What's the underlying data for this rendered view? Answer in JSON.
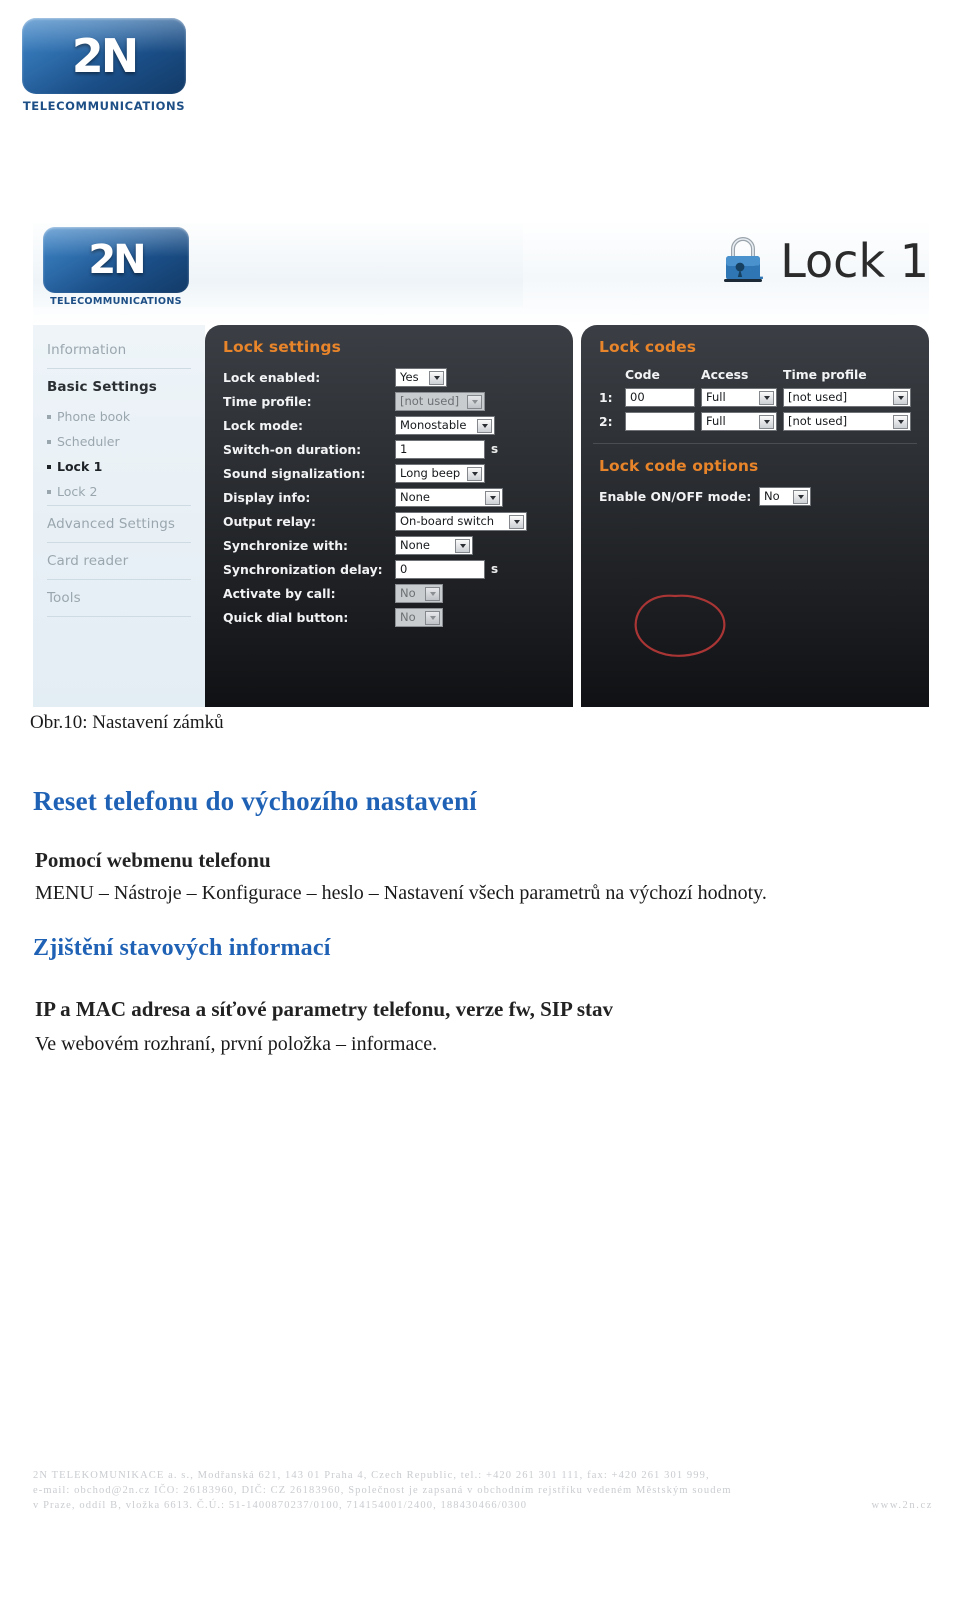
{
  "brand": {
    "mark": "2N",
    "wordmark": "TELECOMMUNICATIONS"
  },
  "screenshot": {
    "page_title": "Lock 1",
    "lock_icon": "padlock-1-icon",
    "nav": {
      "items": [
        {
          "label": "Information",
          "type": "section",
          "active": false
        },
        {
          "label": "Basic Settings",
          "type": "section",
          "active": true
        },
        {
          "label": "Phone book",
          "type": "sub",
          "active": false
        },
        {
          "label": "Scheduler",
          "type": "sub",
          "active": false
        },
        {
          "label": "Lock 1",
          "type": "sub",
          "active": true
        },
        {
          "label": "Lock 2",
          "type": "sub",
          "active": false
        },
        {
          "label": "Advanced Settings",
          "type": "section",
          "active": false
        },
        {
          "label": "Card reader",
          "type": "section",
          "active": false
        },
        {
          "label": "Tools",
          "type": "section",
          "active": false
        }
      ]
    },
    "lock_settings": {
      "title": "Lock settings",
      "fields": [
        {
          "label": "Lock enabled:",
          "value": "Yes",
          "control": "select",
          "disabled": false
        },
        {
          "label": "Time profile:",
          "value": "[not used]",
          "control": "select",
          "disabled": true
        },
        {
          "label": "Lock mode:",
          "value": "Monostable",
          "control": "select",
          "disabled": false
        },
        {
          "label": "Switch-on duration:",
          "value": "1",
          "control": "text",
          "unit": "s"
        },
        {
          "label": "Sound signalization:",
          "value": "Long beep",
          "control": "select",
          "disabled": false
        },
        {
          "label": "Display info:",
          "value": "None",
          "control": "select",
          "disabled": false
        },
        {
          "label": "Output relay:",
          "value": "On-board switch",
          "control": "select",
          "disabled": false
        },
        {
          "label": "Synchronize with:",
          "value": "None",
          "control": "select",
          "disabled": false
        },
        {
          "label": "Synchronization delay:",
          "value": "0",
          "control": "text",
          "unit": "s"
        },
        {
          "label": "Activate by call:",
          "value": "No",
          "control": "select",
          "disabled": true
        },
        {
          "label": "Quick dial button:",
          "value": "No",
          "control": "select",
          "disabled": true
        }
      ]
    },
    "lock_codes": {
      "title": "Lock codes",
      "columns": [
        "Code",
        "Access",
        "Time profile"
      ],
      "rows": [
        {
          "index": "1:",
          "code": "00",
          "access": "Full",
          "time_profile": "[not used]"
        },
        {
          "index": "2:",
          "code": "",
          "access": "Full",
          "time_profile": "[not used]"
        }
      ]
    },
    "lock_code_options": {
      "title": "Lock code options",
      "fields": [
        {
          "label": "Enable ON/OFF mode:",
          "value": "No",
          "control": "select",
          "disabled": false
        }
      ]
    },
    "annotation": {
      "shape": "red-ellipse",
      "color": "#a93535",
      "target": "lock-code-1-field"
    }
  },
  "document": {
    "figure_caption": "Obr.10: Nastavení zámků",
    "section1": {
      "heading": "Reset telefonu do výchozího nastavení",
      "subheading": "Pomocí webmenu telefonu",
      "body": "MENU – Nástroje – Konfigurace – heslo – Nastavení všech parametrů na výchozí hodnoty."
    },
    "section2": {
      "heading": "Zjištění stavových informací",
      "subheading": "IP a MAC adresa a síťové parametry telefonu, verze fw, SIP stav",
      "body": "Ve webovém rozhraní, první položka – informace."
    },
    "accent_color": "#1f62b5"
  },
  "footer": {
    "line1": "2N TELEKOMUNIKACE a. s., Modřanská 621, 143 01 Praha 4, Czech Republic, tel.: +420 261 301 111, fax: +420 261 301 999,",
    "line2": "e-mail: obchod@2n.cz  IČO: 26183960, DIČ: CZ 26183960, Společnost je zapsaná v obchodním rejstříku vedeném Městským soudem",
    "line3": "v Praze, oddíl B, vložka 6613. Č.Ú.: 51-1400870237/0100, 714154001/2400,  188430466/0300",
    "website": "www.2n.cz"
  }
}
